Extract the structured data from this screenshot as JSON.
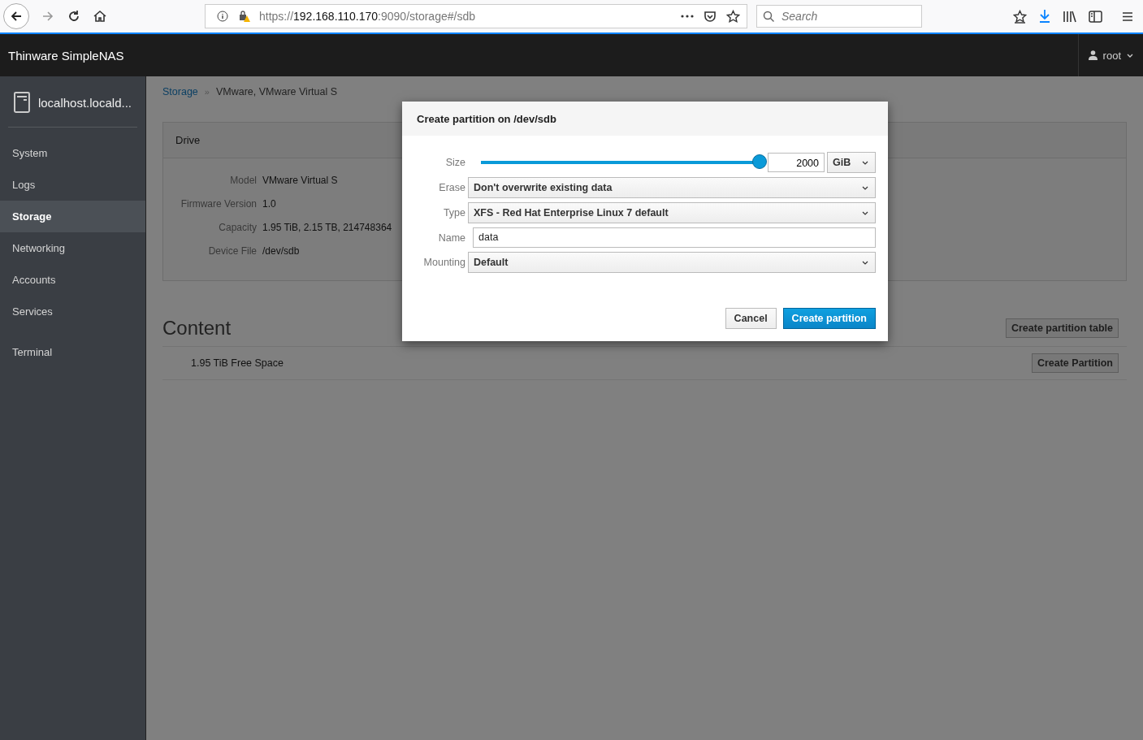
{
  "browser": {
    "url_scheme": "https://",
    "url_host": "192.168.110.170",
    "url_path": ":9090/storage#/sdb",
    "search_placeholder": "Search"
  },
  "header": {
    "brand": "Thinware SimpleNAS",
    "user": "root"
  },
  "sidebar": {
    "host": "localhost.locald...",
    "groups": [
      {
        "items": [
          {
            "label": "System",
            "selected": false
          },
          {
            "label": "Logs",
            "selected": false
          },
          {
            "label": "Storage",
            "selected": true
          },
          {
            "label": "Networking",
            "selected": false
          },
          {
            "label": "Accounts",
            "selected": false
          },
          {
            "label": "Services",
            "selected": false
          }
        ]
      },
      {
        "items": [
          {
            "label": "Terminal",
            "selected": false
          }
        ]
      }
    ]
  },
  "breadcrumb": [
    {
      "label": "Storage",
      "kind": "link"
    },
    {
      "label": "»",
      "kind": "separator"
    },
    {
      "label": "VMware, VMware Virtual S",
      "kind": "current"
    }
  ],
  "drive": {
    "title": "Drive",
    "fields": [
      {
        "label": "Model",
        "value": "VMware Virtual S"
      },
      {
        "label": "Firmware Version",
        "value": "1.0"
      },
      {
        "label": "Capacity",
        "value": "1.95 TiB, 2.15 TB, 214748364"
      },
      {
        "label": "Device File",
        "value": "/dev/sdb"
      }
    ]
  },
  "content": {
    "title": "Content",
    "table_button": "Create partition table",
    "rows": [
      {
        "label": "1.95 TiB Free Space",
        "button": "Create Partition"
      }
    ]
  },
  "dialog": {
    "title": "Create partition on /dev/sdb",
    "size": {
      "label": "Size",
      "level": 1.0,
      "value": "2000",
      "unit": "GiB"
    },
    "fields": [
      {
        "label": "Erase",
        "kind": "select",
        "value": "Don't overwrite existing data"
      },
      {
        "label": "Type",
        "kind": "select",
        "value": "XFS - Red Hat Enterprise Linux 7 default"
      },
      {
        "label": "Name",
        "kind": "input",
        "value": "data"
      },
      {
        "label": "Mounting",
        "kind": "select",
        "value": "Default"
      }
    ],
    "buttons": [
      {
        "label": "Cancel",
        "primary": false
      },
      {
        "label": "Create partition",
        "primary": true
      }
    ]
  }
}
